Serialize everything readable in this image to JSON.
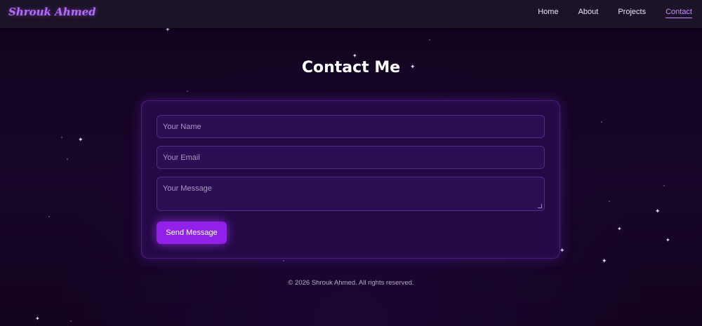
{
  "navbar": {
    "brand": "Shrouk Ahmed",
    "links": [
      {
        "label": "Home"
      },
      {
        "label": "About"
      },
      {
        "label": "Projects"
      },
      {
        "label": "Contact",
        "active": true
      }
    ]
  },
  "main": {
    "title": "Contact Me",
    "form": {
      "name_placeholder": "Your Name",
      "email_placeholder": "Your Email",
      "message_placeholder": "Your Message",
      "submit_label": "Send Message"
    }
  },
  "footer": {
    "text": "© 2026 Shrouk Ahmed. All rights reserved."
  },
  "colors": {
    "accent": "#9120e8",
    "brand": "#b36bff",
    "active_link": "#c48bff",
    "background": "#170629",
    "card": "#240a45"
  },
  "icons": [
    "sparkle-icon",
    "resize-grip-icon"
  ]
}
